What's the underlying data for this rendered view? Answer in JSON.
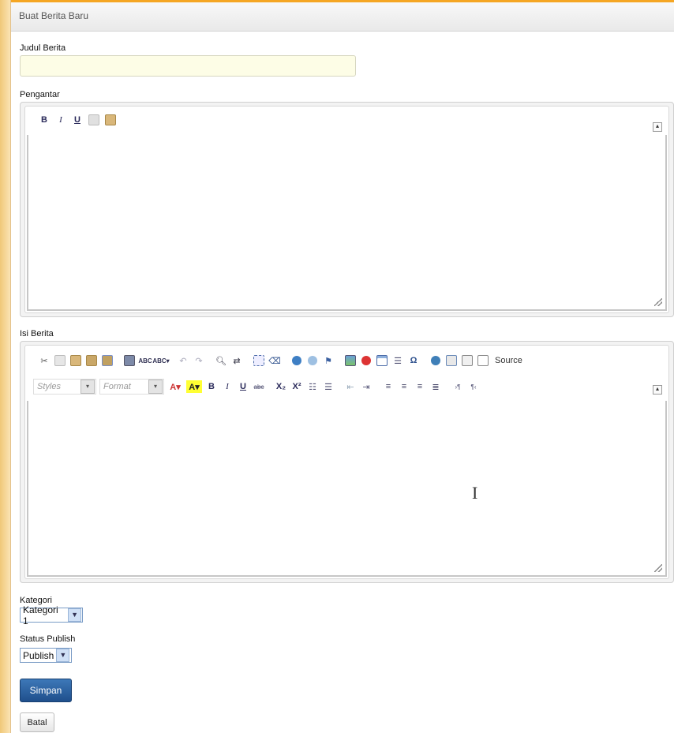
{
  "panel": {
    "title": "Buat Berita Baru"
  },
  "form": {
    "judul_label": "Judul Berita",
    "judul_value": "",
    "pengantar_label": "Pengantar",
    "isi_label": "Isi Berita",
    "kategori_label": "Kategori",
    "kategori_value": "Kategori 1",
    "status_label": "Status Publish",
    "status_value": "Publish",
    "save_label": "Simpan",
    "cancel_label": "Batal"
  },
  "editor_full": {
    "styles_placeholder": "Styles",
    "format_placeholder": "Format",
    "source_label": "Source"
  },
  "icons": {
    "simple_toolbar": [
      "bold-icon",
      "italic-icon",
      "underline-icon",
      "copy-icon",
      "paste-icon"
    ],
    "full_toolbar_row1": [
      "cut-icon",
      "copy-icon",
      "paste-icon",
      "paste-text-icon",
      "paste-word-icon",
      "print-icon",
      "spellcheck-icon",
      "spellcheck-dropdown-icon",
      "undo-icon",
      "redo-icon",
      "find-icon",
      "replace-icon",
      "select-all-icon",
      "remove-format-icon",
      "link-icon",
      "unlink-icon",
      "anchor-icon",
      "image-icon",
      "flash-icon",
      "table-icon",
      "horizontal-rule-icon",
      "special-char-icon",
      "iframe-icon",
      "templates-icon",
      "preview-icon",
      "source-icon"
    ],
    "full_toolbar_row2": [
      "text-color-icon",
      "bg-color-icon",
      "bold-icon",
      "italic-icon",
      "underline-icon",
      "strike-icon",
      "subscript-icon",
      "superscript-icon",
      "numbered-list-icon",
      "bulleted-list-icon",
      "outdent-icon",
      "indent-icon",
      "align-left-icon",
      "align-center-icon",
      "align-right-icon",
      "justify-icon",
      "ltr-icon",
      "rtl-icon"
    ]
  },
  "colors": {
    "accent": "#1f4f8c",
    "top_bar": "#f5a623",
    "input_bg": "#fdfde6"
  }
}
